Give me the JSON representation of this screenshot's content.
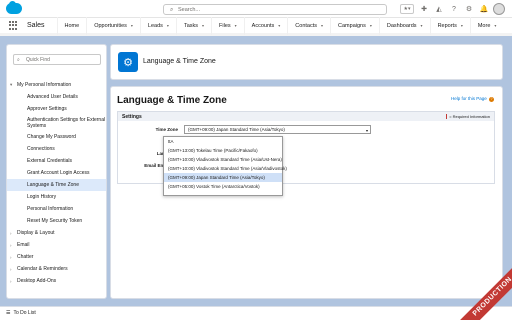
{
  "app": {
    "name": "Sales"
  },
  "search": {
    "placeholder": "Search..."
  },
  "nav": {
    "items": [
      {
        "label": "Home",
        "caret": false
      },
      {
        "label": "Opportunities",
        "caret": true
      },
      {
        "label": "Leads",
        "caret": true
      },
      {
        "label": "Tasks",
        "caret": true
      },
      {
        "label": "Files",
        "caret": true
      },
      {
        "label": "Accounts",
        "caret": true
      },
      {
        "label": "Contacts",
        "caret": true
      },
      {
        "label": "Campaigns",
        "caret": true
      },
      {
        "label": "Dashboards",
        "caret": true
      },
      {
        "label": "Reports",
        "caret": true
      },
      {
        "label": "More",
        "caret": true
      }
    ]
  },
  "sidebar": {
    "quick_find_placeholder": "Quick Find",
    "items": [
      {
        "label": "My Personal Information",
        "chevron": "▾",
        "sub": false
      },
      {
        "label": "Advanced User Details",
        "sub": true
      },
      {
        "label": "Approver Settings",
        "sub": true
      },
      {
        "label": "Authentication Settings for External Systems",
        "sub": true,
        "two": true
      },
      {
        "label": "Change My Password",
        "sub": true
      },
      {
        "label": "Connections",
        "sub": true
      },
      {
        "label": "External Credentials",
        "sub": true
      },
      {
        "label": "Grant Account Login Access",
        "sub": true
      },
      {
        "label": "Language & Time Zone",
        "sub": true,
        "active": true
      },
      {
        "label": "Login History",
        "sub": true
      },
      {
        "label": "Personal Information",
        "sub": true
      },
      {
        "label": "Reset My Security Token",
        "sub": true
      },
      {
        "label": "Display & Layout",
        "chevron": "›",
        "sub": false
      },
      {
        "label": "Email",
        "chevron": "›",
        "sub": false
      },
      {
        "label": "Chatter",
        "chevron": "›",
        "sub": false
      },
      {
        "label": "Calendar & Reminders",
        "chevron": "›",
        "sub": false
      },
      {
        "label": "Desktop Add-Ons",
        "chevron": "›",
        "sub": false
      }
    ]
  },
  "page_header": {
    "title": "Language & Time Zone"
  },
  "panel": {
    "title": "Language & Time Zone",
    "help_link": "Help for this Page",
    "section_title": "Settings",
    "required_note": "= Required Information",
    "fields": {
      "time_zone": {
        "label": "Time Zone",
        "value": "(GMT+09:00) Japan Standard Time (Asia/Tokyo)"
      },
      "locale": {
        "label": "Locale",
        "value": "Japan"
      },
      "language": {
        "label": "Language",
        "value": "Engl"
      },
      "email_encoding": {
        "label": "Email Encoding",
        "value": "Japa"
      }
    }
  },
  "dropdown": {
    "options": [
      {
        "label": "ttA",
        "selected": false
      },
      {
        "label": "(GMT+13:00) Tokelau Time (Pacific/Fakaofo)",
        "selected": false
      },
      {
        "label": "(GMT+10:00) Vladivostok Standard Time (Asia/Ust-Nera)",
        "selected": false
      },
      {
        "label": "(GMT+10:00) Vladivostok Standard Time (Asia/Vladivostok)",
        "selected": false
      },
      {
        "label": "(GMT+09:00) Japan Standard Time (Asia/Tokyo)",
        "selected": true
      },
      {
        "label": "(GMT+05:00) Vostok Time (Antarctica/Vostok)",
        "selected": false
      }
    ]
  },
  "footer": {
    "todo_label": "To Do List"
  },
  "banner": {
    "label": "PRODUCTION"
  },
  "colors": {
    "accent": "#0176d3",
    "brand": "#00a1e0",
    "active_bg": "#dce9fa",
    "banner": "#c23934",
    "page_bg": "#b0c4df"
  }
}
